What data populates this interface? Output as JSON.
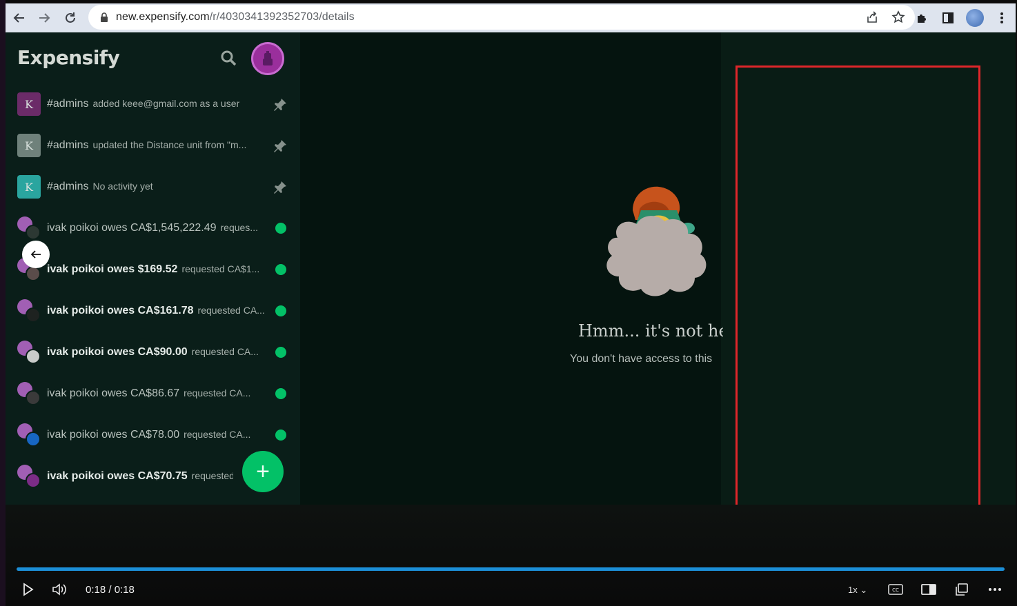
{
  "browser": {
    "url_domain": "new.expensify.com",
    "url_path": "/r/4030341392352703/details"
  },
  "app": {
    "logo": "Expensify",
    "fab_label": "+",
    "chats": [
      {
        "name": "#admins",
        "preview": "added keee@gmail.com as a user",
        "avatar_letter": "K",
        "avatar_color": "#6b2b68",
        "pinned": true,
        "bold": false
      },
      {
        "name": "#admins",
        "preview": "updated the Distance unit from \"m...",
        "avatar_letter": "K",
        "avatar_color": "#6f817b",
        "pinned": true,
        "bold": false
      },
      {
        "name": "#admins",
        "preview": "No activity yet",
        "avatar_letter": "K",
        "avatar_color": "#2aa59f",
        "pinned": true,
        "bold": false
      },
      {
        "name": "ivak poikoi owes CA$1,545,222.49",
        "preview": "reques...",
        "bold": false,
        "unread": true
      },
      {
        "name": "ivak poikoi owes $169.52",
        "preview": "requested CA$1...",
        "bold": true,
        "unread": true
      },
      {
        "name": "ivak poikoi owes CA$161.78",
        "preview": "requested CA...",
        "bold": true,
        "unread": true
      },
      {
        "name": "ivak poikoi owes CA$90.00",
        "preview": "requested CA...",
        "bold": true,
        "unread": true
      },
      {
        "name": "ivak poikoi owes CA$86.67",
        "preview": "requested CA...",
        "bold": false,
        "unread": true
      },
      {
        "name": "ivak poikoi owes CA$78.00",
        "preview": "requested CA...",
        "bold": false,
        "unread": true
      },
      {
        "name": "ivak poikoi owes CA$70.75",
        "preview": "requested",
        "bold": true,
        "unread": false
      }
    ],
    "not_found": {
      "title": "Hmm... it's not he",
      "subtitle": "You don't have access to this"
    }
  },
  "video": {
    "time": "0:18 / 0:18",
    "speed": "1x",
    "progress_fraction": 1.0
  },
  "colors": {
    "accent_green": "#03c167",
    "highlight_red": "#e0262a",
    "progress_blue": "#1c8fd8"
  }
}
